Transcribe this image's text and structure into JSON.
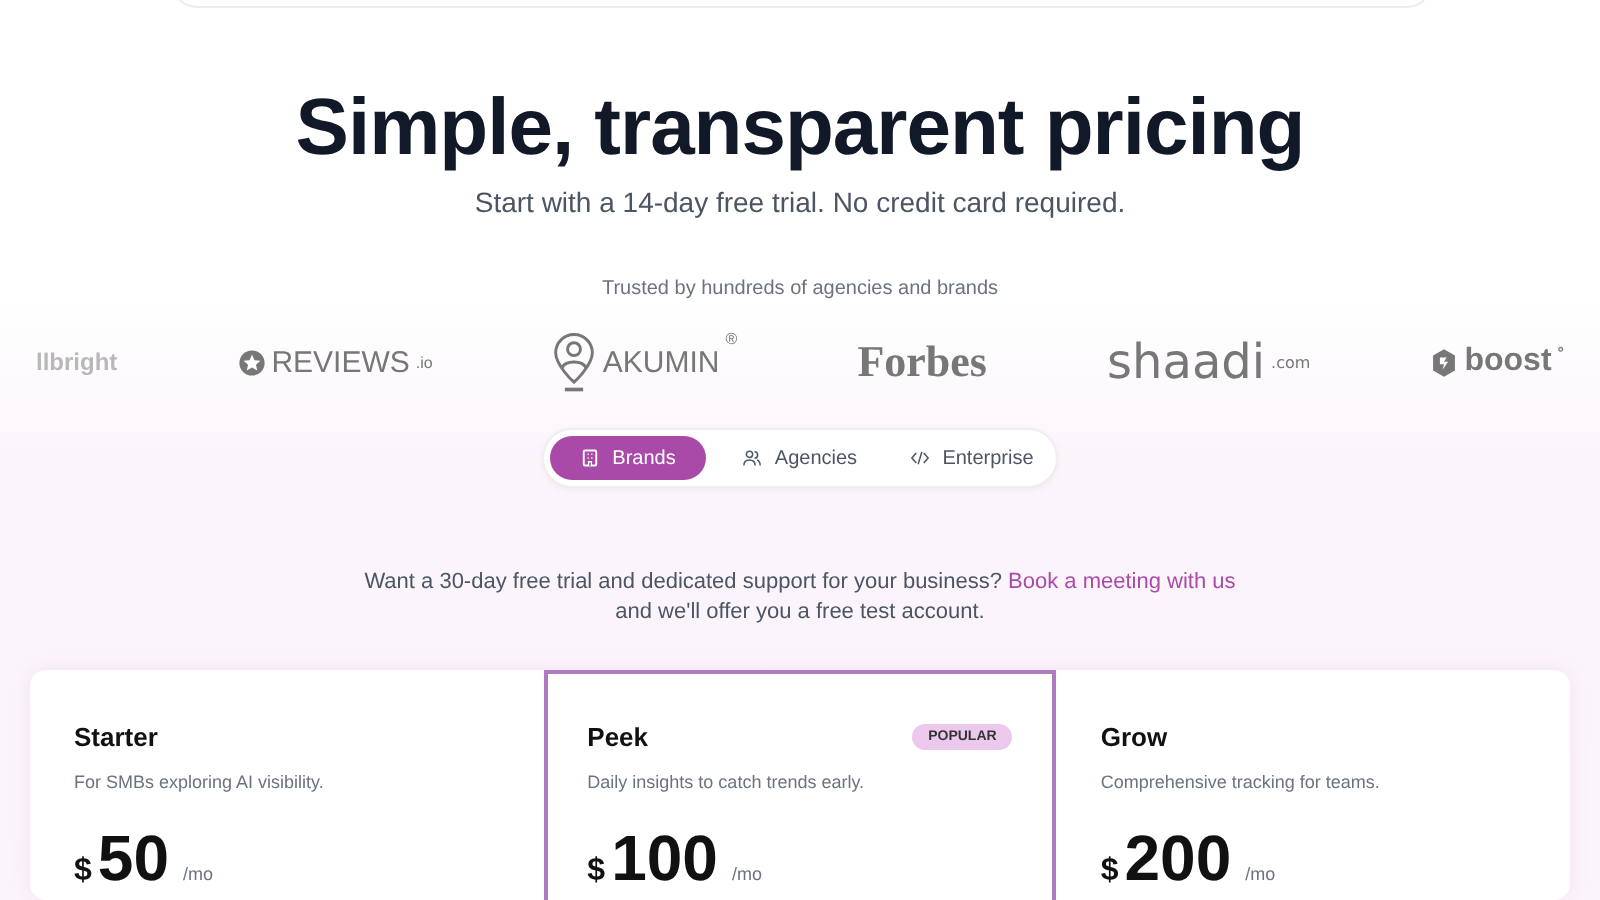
{
  "hero": {
    "title": "Simple, transparent pricing",
    "subtitle": "Start with a 14-day free trial. No credit card required."
  },
  "trusted": {
    "caption": "Trusted by hundreds of agencies and brands",
    "logos": [
      {
        "kind": "plain",
        "text": "llbright"
      },
      {
        "kind": "star",
        "text": "REVIEWS",
        "suffix": ".io"
      },
      {
        "kind": "pin",
        "text": "AKUMIN",
        "suffix": "®"
      },
      {
        "kind": "serif",
        "text": "Forbes"
      },
      {
        "kind": "script",
        "text": "shaadi",
        "suffix": ".com"
      },
      {
        "kind": "cube",
        "text": "boost",
        "suffix": "°"
      }
    ]
  },
  "tabs": [
    {
      "label": "Brands",
      "selected": true
    },
    {
      "label": "Agencies",
      "selected": false
    },
    {
      "label": "Enterprise",
      "selected": false
    }
  ],
  "offer": {
    "before": "Want a 30-day free trial and dedicated support for your business? ",
    "link": "Book a meeting with us",
    "after": " and we'll offer you a free test account."
  },
  "plans": [
    {
      "name": "Starter",
      "description": "For SMBs exploring AI visibility.",
      "currency": "$",
      "price": "50",
      "period": "/mo",
      "highlighted": false
    },
    {
      "name": "Peek",
      "description": "Daily insights to catch trends early.",
      "currency": "$",
      "price": "100",
      "period": "/mo",
      "highlighted": true,
      "badge": "POPULAR"
    },
    {
      "name": "Grow",
      "description": "Comprehensive tracking for teams.",
      "currency": "$",
      "price": "200",
      "period": "/mo",
      "highlighted": false
    }
  ]
}
